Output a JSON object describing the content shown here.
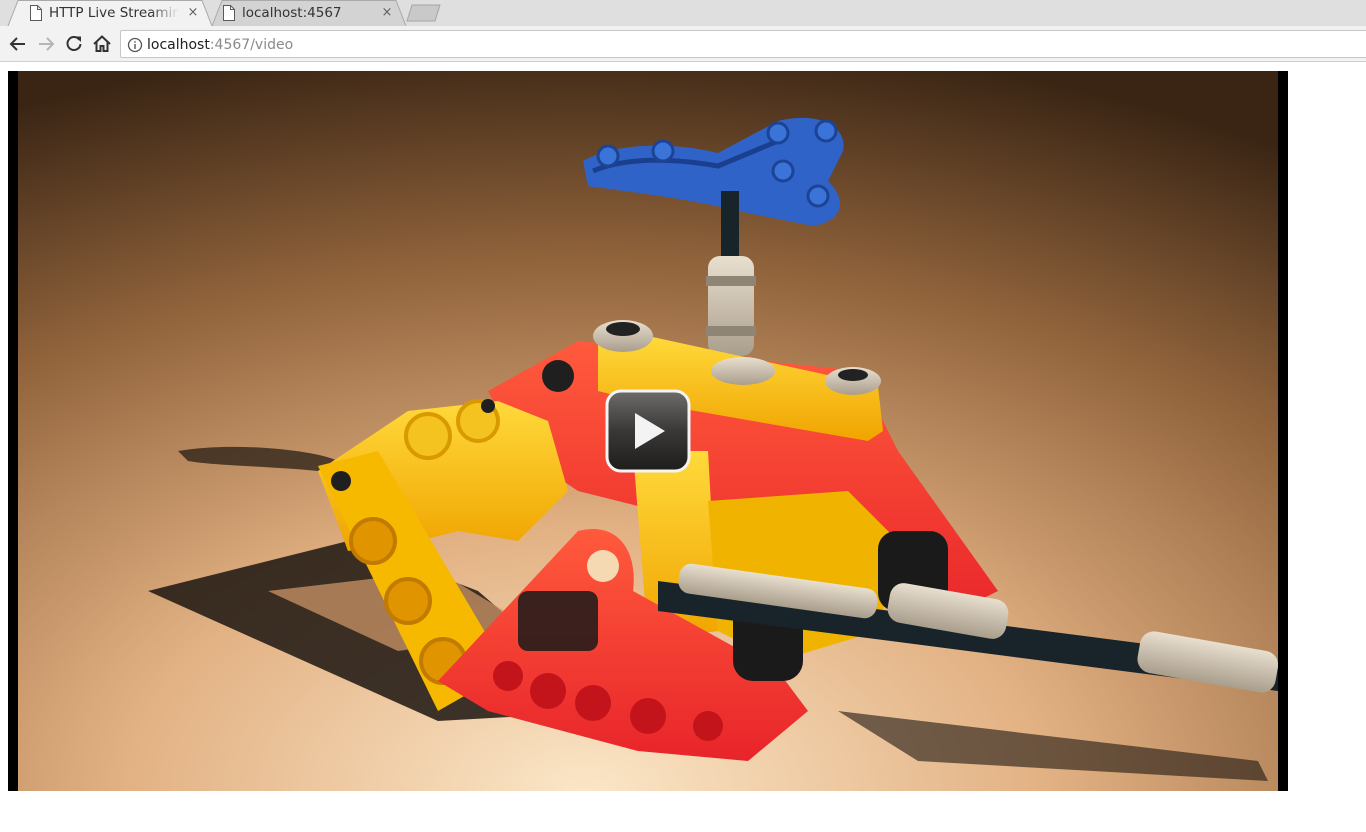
{
  "tabs": [
    {
      "title": "HTTP Live Streamin",
      "active": true,
      "favicon": "page-icon",
      "close": "×"
    },
    {
      "title": "localhost:4567",
      "active": false,
      "favicon": "page-icon",
      "close": "×"
    }
  ],
  "toolbar": {
    "back": "arrow-left-icon",
    "forward": "arrow-right-icon",
    "reload": "reload-icon",
    "home": "home-icon"
  },
  "address": {
    "host": "localhost",
    "rest": ":4567/video",
    "info_icon": "info-icon"
  },
  "video": {
    "play_icon": "play-icon",
    "subject": "lego technic helicopter model"
  },
  "colors": {
    "tabstrip": "#dfdfdf",
    "active_tab": "#f2f2f2",
    "letterbox": "#000000"
  }
}
